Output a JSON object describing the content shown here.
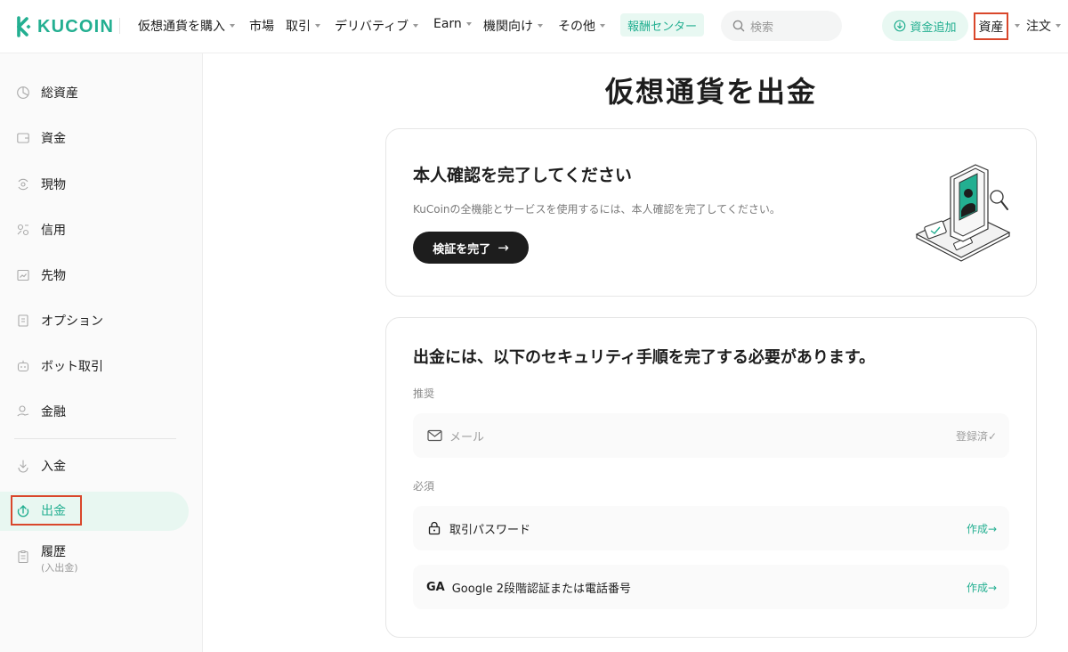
{
  "brand": {
    "name": "KUCOIN",
    "accent": "#23af91",
    "highlight": "#d9472b"
  },
  "nav": {
    "items": [
      {
        "label": "仮想通貨を購入",
        "caret": true
      },
      {
        "label": "市場",
        "caret": false
      },
      {
        "label": "取引",
        "caret": true
      },
      {
        "label": "デリバティブ",
        "caret": true
      },
      {
        "label": "Earn",
        "caret": true
      },
      {
        "label": "機関向け",
        "caret": true
      },
      {
        "label": "その他",
        "caret": true
      }
    ],
    "reward_center": "報酬センター",
    "search_placeholder": "検索",
    "add_funds": "資金追加",
    "assets": "資産",
    "orders": "注文"
  },
  "sidebar": {
    "items": [
      {
        "label": "総資産",
        "icon": "pie-chart-icon"
      },
      {
        "label": "資金",
        "icon": "wallet-icon"
      },
      {
        "label": "現物",
        "icon": "spot-icon"
      },
      {
        "label": "信用",
        "icon": "margin-icon"
      },
      {
        "label": "先物",
        "icon": "futures-icon"
      },
      {
        "label": "オプション",
        "icon": "options-icon"
      },
      {
        "label": "ボット取引",
        "icon": "bot-icon"
      },
      {
        "label": "金融",
        "icon": "finance-icon"
      },
      {
        "label": "入金",
        "icon": "deposit-icon"
      },
      {
        "label": "出金",
        "icon": "withdraw-icon",
        "active": true
      },
      {
        "label": "履歴",
        "sub": "(入出金)",
        "icon": "history-icon"
      }
    ]
  },
  "page": {
    "title": "仮想通貨を出金"
  },
  "kyc": {
    "title": "本人確認を完了してください",
    "description": "KuCoinの全機能とサービスを使用するには、本人確認を完了してください。",
    "button": "検証を完了",
    "button_arrow": "→"
  },
  "security": {
    "title": "出金には、以下のセキュリティ手順を完了する必要があります。",
    "recommended_label": "推奨",
    "required_label": "必須",
    "recommended": [
      {
        "label": "メール",
        "status": "登録済✓",
        "icon": "mail-icon"
      }
    ],
    "required": [
      {
        "label": "取引パスワード",
        "status": "作成→",
        "icon": "lock-icon"
      },
      {
        "prefix": "GA",
        "label": "Google 2段階認証または電話番号",
        "status": "作成→",
        "icon": "ga-icon"
      }
    ]
  }
}
